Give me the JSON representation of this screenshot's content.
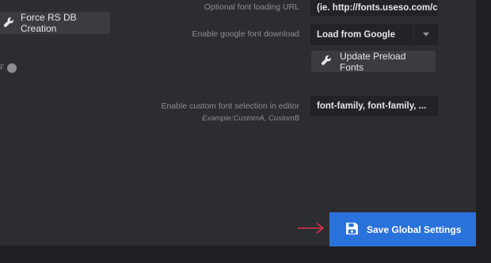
{
  "left": {
    "force_button_label": "Force RS DB Creation",
    "toggle_text": "F"
  },
  "settings": {
    "optional_font_label": "Optional font loading URL",
    "optional_font_value": "(ie. http://fonts.useso.com/c",
    "google_download_label": "Enable google font download",
    "google_download_value": "Load from Google",
    "update_preload_label": "Update Preload Fonts",
    "custom_font_label": "Enable custom font selection in editor",
    "custom_font_example": "Example:CustomA, CustomB",
    "custom_font_value": "font-family, font-family, ..."
  },
  "footer": {
    "save_label": "Save Global Settings"
  },
  "colors": {
    "accent": "#2a72db",
    "arrow": "#e0304a"
  }
}
